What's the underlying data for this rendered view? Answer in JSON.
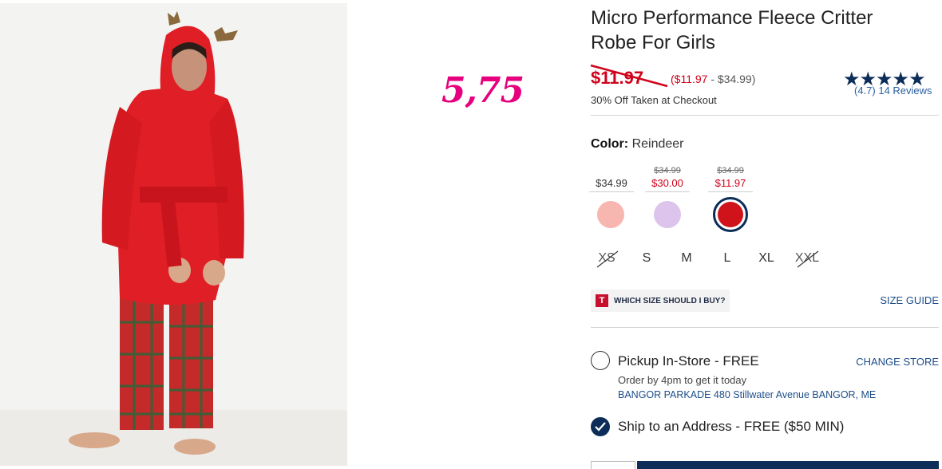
{
  "annotation": "5,75",
  "product": {
    "title": "Micro Performance Fleece Critter Robe For Girls",
    "sale_price": "$11.97",
    "range_low": "($11.97",
    "range_sep": " - $34.99)",
    "discount_note": "30% Off Taken at Checkout",
    "stars": "★★★★★",
    "rating_text": "(4.7) 14 Reviews",
    "rating_value": 4.7
  },
  "color": {
    "label": "Color:",
    "value": "Reindeer",
    "swatches": [
      {
        "was": "",
        "now": "$34.99",
        "fill": "#f7b7b0"
      },
      {
        "was": "$34.99",
        "now": "$30.00",
        "fill": "#dcc4ec"
      },
      {
        "was": "$34.99",
        "now": "$11.97",
        "fill": "#d0121b"
      }
    ]
  },
  "sizes": [
    {
      "label": "XS",
      "available": false
    },
    {
      "label": "S",
      "available": true
    },
    {
      "label": "M",
      "available": true
    },
    {
      "label": "L",
      "available": true
    },
    {
      "label": "XL",
      "available": true
    },
    {
      "label": "XXL",
      "available": false
    }
  ],
  "fit": {
    "badge": "T",
    "help_text": "WHICH SIZE SHOULD I BUY?",
    "size_guide": "SIZE GUIDE"
  },
  "fulfillment": {
    "pickup_title": "Pickup In-Store - FREE",
    "pickup_sub": "Order by 4pm to get it today",
    "store": "BANGOR PARKADE 480 Stillwater Avenue  BANGOR, ME",
    "change_store": "CHANGE STORE",
    "ship_title": "Ship to an Address - FREE ($50 MIN)"
  },
  "colors": {
    "brand_navy": "#0b2d58",
    "sale_red": "#d0021b",
    "link_blue": "#1d4e89",
    "annotation_pink": "#e6007e"
  }
}
